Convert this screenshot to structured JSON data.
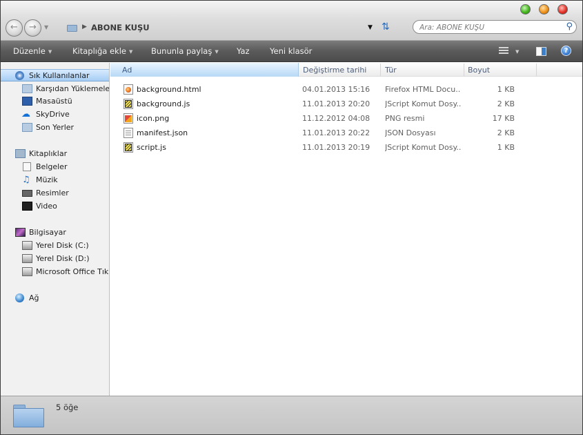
{
  "window": {
    "title": "ABONE KUŞU"
  },
  "address": {
    "path": "ABONE KUŞU"
  },
  "search": {
    "placeholder": "Ara: ABONE KUŞU"
  },
  "toolbar": {
    "items": [
      {
        "label": "Düzenle",
        "has_arrow": true
      },
      {
        "label": "Kitaplığa ekle",
        "has_arrow": true
      },
      {
        "label": "Bununla paylaş",
        "has_arrow": true
      },
      {
        "label": "Yaz",
        "has_arrow": false
      },
      {
        "label": "Yeni klasör",
        "has_arrow": false
      }
    ],
    "help_label": "?"
  },
  "nav": {
    "favorites": {
      "title": "Sık Kullanılanlar",
      "items": [
        "Karşıdan Yüklemeler",
        "Masaüstü",
        "SkyDrive",
        "Son Yerler"
      ]
    },
    "libraries": {
      "title": "Kitaplıklar",
      "items": [
        "Belgeler",
        "Müzik",
        "Resimler",
        "Video"
      ]
    },
    "computer": {
      "title": "Bilgisayar",
      "items": [
        "Yerel Disk (C:)",
        "Yerel Disk (D:)",
        "Microsoft Office Tıkla"
      ]
    },
    "network": {
      "title": "Ağ"
    }
  },
  "columns": {
    "name": "Ad",
    "date": "Değiştirme tarihi",
    "type": "Tür",
    "size": "Boyut"
  },
  "files": [
    {
      "name": "background.html",
      "date": "04.01.2013 15:16",
      "type": "Firefox HTML Docu...",
      "size": "1 KB",
      "icon": "firefox-html-icon"
    },
    {
      "name": "background.js",
      "date": "11.01.2013 20:20",
      "type": "JScript Komut Dosy...",
      "size": "2 KB",
      "icon": "jscript-icon"
    },
    {
      "name": "icon.png",
      "date": "11.12.2012 04:08",
      "type": "PNG resmi",
      "size": "17 KB",
      "icon": "png-image-icon"
    },
    {
      "name": "manifest.json",
      "date": "11.01.2013 20:22",
      "type": "JSON Dosyası",
      "size": "2 KB",
      "icon": "json-file-icon"
    },
    {
      "name": "script.js",
      "date": "11.01.2013 20:19",
      "type": "JScript Komut Dosy...",
      "size": "1 KB",
      "icon": "jscript-icon"
    }
  ],
  "status": {
    "count": "5 öğe"
  }
}
